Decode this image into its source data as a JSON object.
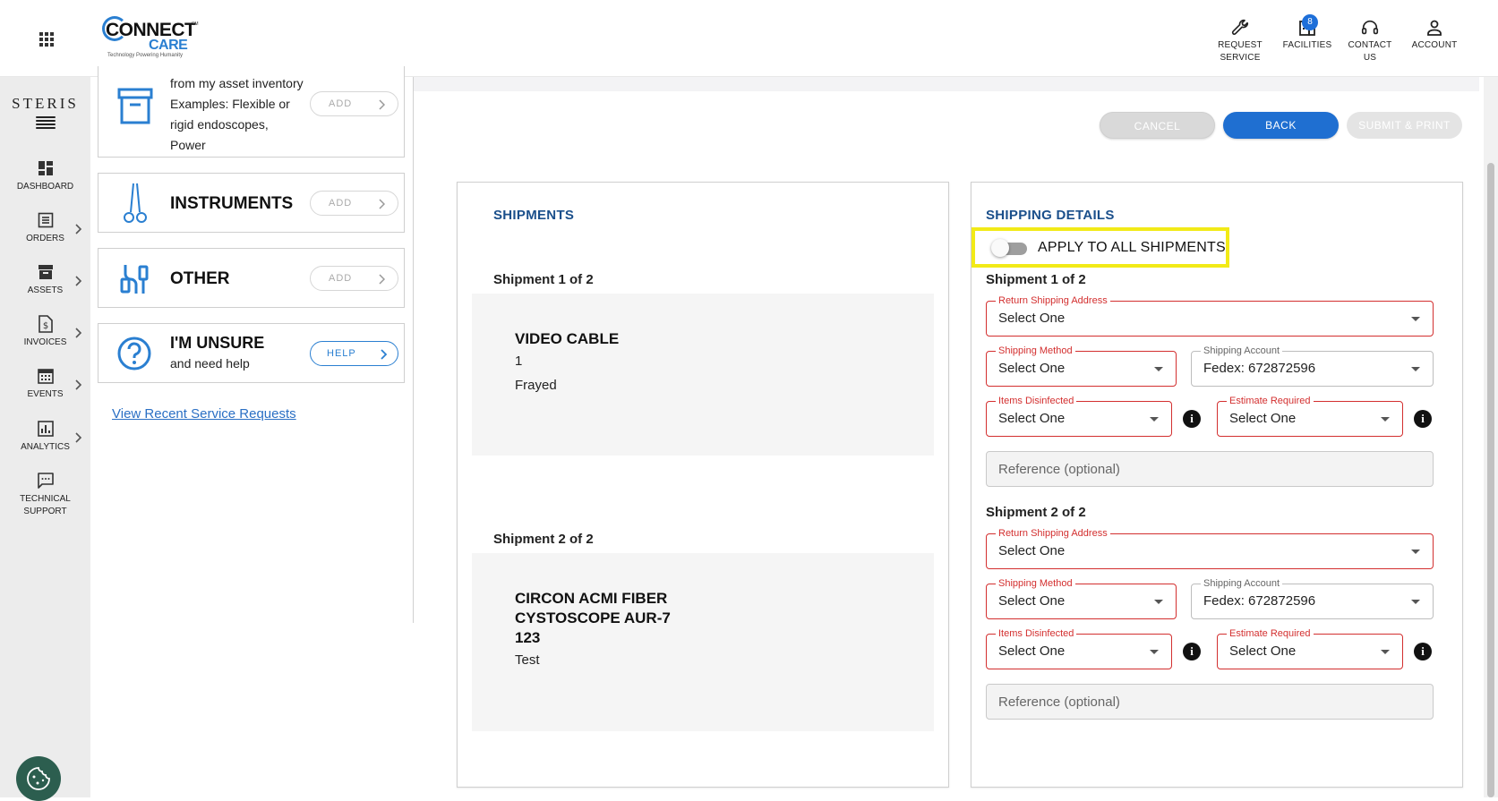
{
  "header": {
    "logo_text": "CONNECT",
    "logo_sub": "CARE",
    "logo_mark": "SM",
    "logo_tagline": "Technology Powering Humanity",
    "nav": [
      {
        "label_1": "REQUEST",
        "label_2": "SERVICE",
        "icon": "wrench-icon"
      },
      {
        "label_1": "FACILITIES",
        "label_2": "",
        "icon": "building-icon",
        "badge": "8"
      },
      {
        "label_1": "CONTACT",
        "label_2": "US",
        "icon": "headset-icon"
      },
      {
        "label_1": "ACCOUNT",
        "label_2": "",
        "icon": "person-icon"
      }
    ]
  },
  "rail": {
    "brand": "STERIS",
    "items": [
      {
        "label": "DASHBOARD",
        "icon": "dashboard-icon"
      },
      {
        "label": "ORDERS",
        "icon": "orders-icon"
      },
      {
        "label": "ASSETS",
        "icon": "assets-icon"
      },
      {
        "label": "INVOICES",
        "icon": "invoice-icon"
      },
      {
        "label": "EVENTS",
        "icon": "calendar-icon"
      },
      {
        "label": "ANALYTICS",
        "icon": "chart-icon"
      },
      {
        "label_1": "TECHNICAL",
        "label_2": "SUPPORT",
        "icon": "chat-icon"
      }
    ]
  },
  "categories": {
    "asset_desc_1": "from my asset inventory",
    "asset_desc_2": "Examples: Flexible or",
    "asset_desc_3": "rigid endoscopes,",
    "asset_desc_4": "Power",
    "instruments": "INSTRUMENTS",
    "other": "OTHER",
    "unsure": "I'M UNSURE",
    "unsure_sub": "and need help",
    "add_label": "ADD",
    "help_label": "HELP",
    "recent_link": "View Recent Service Requests"
  },
  "actions": {
    "cancel": "CANCEL",
    "back": "BACK",
    "submit": "SUBMIT & PRINT"
  },
  "shipments": {
    "title": "SHIPMENTS",
    "list": [
      {
        "label": "Shipment 1 of 2",
        "name_1": "VIDEO CABLE",
        "name_2": "",
        "name_3": "",
        "qty": "1",
        "note": "Frayed"
      },
      {
        "label": "Shipment 2 of 2",
        "name_1": "CIRCON ACMI FIBER",
        "name_2": "CYSTOSCOPE AUR-7",
        "name_3": "123",
        "qty": "",
        "note": "Test"
      }
    ]
  },
  "details": {
    "title": "SHIPPING DETAILS",
    "toggle_label": "APPLY TO ALL SHIPMENTS",
    "toggle_on": false,
    "groups": [
      {
        "label": "Shipment 1 of 2",
        "return_label": "Return Shipping Address",
        "return_value": "Select One",
        "method_label": "Shipping Method",
        "method_value": "Select One",
        "account_label": "Shipping Account",
        "account_value": "Fedex: 672872596",
        "disinfected_label": "Items Disinfected",
        "disinfected_value": "Select One",
        "estimate_label": "Estimate Required",
        "estimate_value": "Select One",
        "reference_placeholder": "Reference (optional)"
      },
      {
        "label": "Shipment 2 of 2",
        "return_label": "Return Shipping Address",
        "return_value": "Select One",
        "method_label": "Shipping Method",
        "method_value": "Select One",
        "account_label": "Shipping Account",
        "account_value": "Fedex: 672872596",
        "disinfected_label": "Items Disinfected",
        "disinfected_value": "Select One",
        "estimate_label": "Estimate Required",
        "estimate_value": "Select One",
        "reference_placeholder": "Reference (optional)"
      }
    ],
    "info_glyph": "i"
  },
  "colors": {
    "accent": "#1f6fd1",
    "error": "#d32f2f",
    "highlight": "#f2ea17",
    "section_title": "#1a4f8b"
  }
}
